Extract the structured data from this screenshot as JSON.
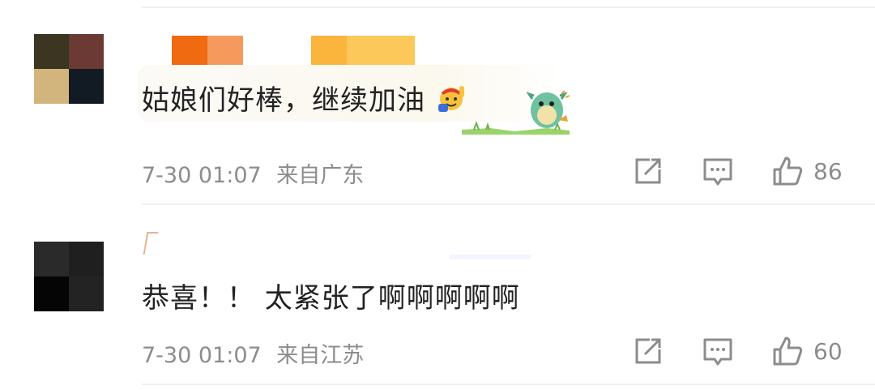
{
  "comments": [
    {
      "text": "姑娘们好棒，继续加油",
      "time": "7-30 01:07",
      "location": "来自广东",
      "likes": "86",
      "emoji_icon": "cheering-face-icon",
      "sticker_icon": "green-dinosaur-sticker-icon"
    },
    {
      "text": "恭喜！！ 太紧张了啊啊啊啊啊",
      "time": "7-30 01:07",
      "location": "来自江苏",
      "likes": "60"
    }
  ],
  "icons": {
    "share": "share-icon",
    "reply": "comment-icon",
    "like": "thumbs-up-icon"
  },
  "colors": {
    "text": "#222222",
    "meta": "#8c8c8c",
    "icon": "#8c8c8c",
    "divider": "#f0f0f0"
  }
}
